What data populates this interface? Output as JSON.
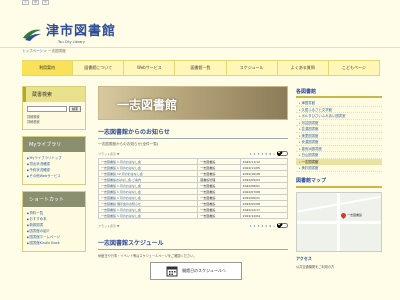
{
  "a11y": [
    "小",
    "中",
    "大"
  ],
  "site": {
    "title": "津市図書館",
    "subtitle": "Tsu City Library"
  },
  "breadcrumb": {
    "home": "トップページ",
    "sep": " > ",
    "current": "一志図書館"
  },
  "nav": [
    "利用案内",
    "図書館について",
    "Webサービス",
    "図書館一覧",
    "スケジュール",
    "よくある質問",
    "こどもページ"
  ],
  "left": {
    "search": {
      "title": "蔵書検索",
      "button": "検索",
      "link1": "詳細検索",
      "link2": "詳細検索"
    },
    "mylib": {
      "title": "Myライブラリ",
      "links": [
        "Myライブラリトップ",
        "貸出状況確認",
        "予約状況確認",
        "その他Webサービス"
      ]
    },
    "shortcut": {
      "title": "ショートカット",
      "links": [
        "資料一覧",
        "おすすめ本",
        "新着図書",
        "図書館の紹介",
        "図書館ホームページ",
        "図書館Kindle Book"
      ]
    }
  },
  "main": {
    "banner": "一志図書館",
    "news_title": "一志図書館からのお知らせ",
    "news_sub": "一志図書館からのお知らせ(全件一覧)",
    "pager": {
      "left": "フラット表示 ▼",
      "pages": [
        "1",
        "2",
        "3",
        "4",
        "5",
        "6",
        "»"
      ],
      "select": "10件"
    },
    "rows": [
      {
        "t": "一志図書館 1 月のおはなし会",
        "c": "一志図書館",
        "d": "2022/11/12"
      },
      {
        "t": "一志図書館 1 月のおはなし会",
        "c": "一志図書館",
        "d": "2022/11/05"
      },
      {
        "t": "一志図書館 12 月のおはなし会",
        "c": "一志図書館",
        "d": "2022/10/28"
      },
      {
        "t": "一志図書館おはなし会 ご案内",
        "c": "図書館管理",
        "d": "2022/09/03"
      },
      {
        "t": "一志図書館 1 月のおはなし会",
        "c": "一志図書館",
        "d": "2022/08/01"
      },
      {
        "t": "一志図書館 1 月のおはなし会",
        "c": "一志図書館",
        "d": "2022/07/08"
      },
      {
        "t": "一志図書館 1 月のおはなし会",
        "c": "一志図書館",
        "d": "2022/06/21"
      },
      {
        "t": "一志図書館 展示会のお知らせ",
        "c": "一志図書館",
        "d": "2022/05/08"
      },
      {
        "t": "一志図書館 1 月のおはなし会",
        "c": "一志図書館",
        "d": "2022/12/17"
      },
      {
        "t": "一志図書館 1 月のおはなし会",
        "c": "一志図書館",
        "d": "2022/12/04"
      }
    ],
    "pager2": {
      "left": "フラット表示 ▼",
      "pages": [
        "1",
        "2",
        "3",
        "4",
        "5",
        "6",
        "»"
      ],
      "select": "10件"
    },
    "sched_title": "一志図書館スケジュール",
    "sched_note": "休館日や行事・イベント等はスケジュールページをご確認ください。",
    "sched_btn": "開館日のスケジュールへ"
  },
  "right": {
    "title": "各図書館",
    "list": [
      "津図書館",
      "久居ふるさと文学館",
      "ポルタひさいふれあい図書室",
      "河芸図書館",
      "芸濃図書館",
      "美里図書館",
      "安濃図書館",
      "香良洲図書館",
      "白山図書館",
      "一志図書館",
      "美杉図書館"
    ],
    "current_index": 9,
    "map_title": "図書館マップ",
    "map_label": "一志図書館",
    "access_title": "アクセス",
    "access_note": "公共交通機関をご利用の方"
  }
}
